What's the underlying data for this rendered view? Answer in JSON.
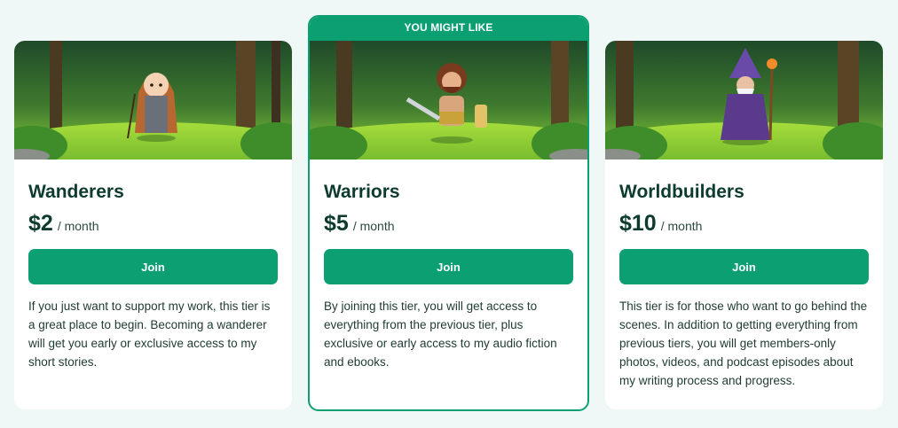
{
  "highlight_label": "YOU MIGHT LIKE",
  "tiers": [
    {
      "name": "Wanderers",
      "price": "$2",
      "period": "/ month",
      "join_label": "Join",
      "description": "If you just want to support my work, this tier is a great place to begin. Becoming a wanderer will get you early or exclusive access to my short stories.",
      "image": "wanderer-character-forest-illustration"
    },
    {
      "name": "Warriors",
      "price": "$5",
      "period": "/ month",
      "join_label": "Join",
      "description": "By joining this tier, you will get access to everything from the previous tier, plus exclusive or early access to my audio fiction and ebooks.",
      "image": "warrior-character-forest-illustration"
    },
    {
      "name": "Worldbuilders",
      "price": "$10",
      "period": "/ month",
      "join_label": "Join",
      "description": "This tier is for those who want to go behind the scenes. In addition to getting everything from previous tiers, you will get members-only photos, videos, and podcast episodes about my writing process and progress.",
      "image": "wizard-character-forest-illustration"
    }
  ],
  "colors": {
    "accent": "#0b9f72",
    "background": "#eff8f6",
    "text": "#0d3b2e"
  }
}
